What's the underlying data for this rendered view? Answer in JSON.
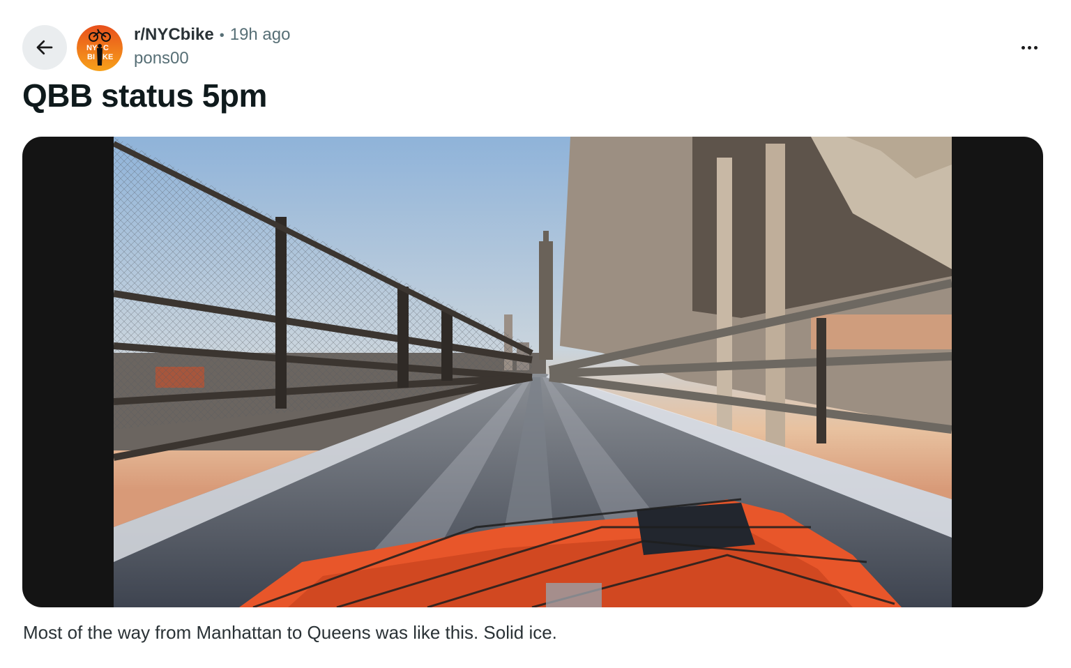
{
  "post": {
    "subreddit": "r/NYCbike",
    "separator": "•",
    "time_ago": "19h ago",
    "author": "pons00",
    "title": "QBB status 5pm",
    "body": "Most of the way from Manhattan to Queens was like this. Solid ice."
  },
  "avatar": {
    "logo_text": "NYC BIKE",
    "colors": [
      "#f36c21",
      "#f7a11a"
    ]
  },
  "icons": {
    "back": "arrow-left-icon",
    "overflow": "more-horizontal-icon"
  },
  "colors": {
    "meta_text": "#576f76",
    "back_button_bg": "#eaedef",
    "media_bg": "#141414"
  }
}
